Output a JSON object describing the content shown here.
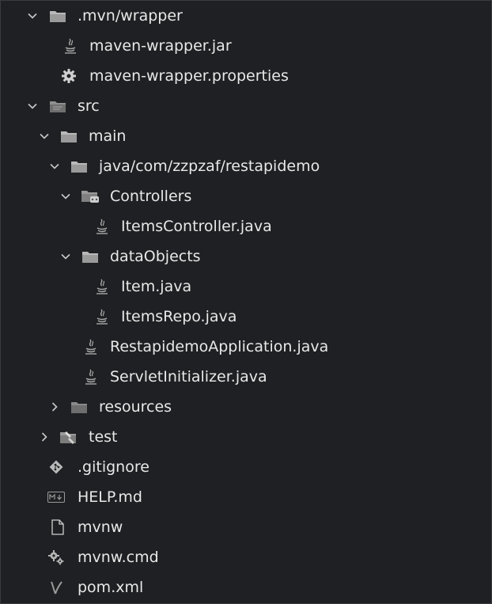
{
  "tree": {
    "items": [
      {
        "label": ".mvn/wrapper",
        "type": "folder",
        "state": "expanded",
        "icon": "folder-icon"
      },
      {
        "label": "maven-wrapper.jar",
        "type": "file",
        "icon": "java-file-icon"
      },
      {
        "label": "maven-wrapper.properties",
        "type": "file",
        "icon": "gear-icon"
      },
      {
        "label": "src",
        "type": "folder",
        "state": "expanded",
        "icon": "folder-icon"
      },
      {
        "label": "main",
        "type": "folder",
        "state": "expanded",
        "icon": "folder-icon"
      },
      {
        "label": "java/com/zzpzaf/restapidemo",
        "type": "folder",
        "state": "expanded",
        "icon": "folder-icon"
      },
      {
        "label": "Controllers",
        "type": "folder",
        "state": "expanded",
        "icon": "controllers-folder-icon"
      },
      {
        "label": "ItemsController.java",
        "type": "file",
        "icon": "java-file-icon"
      },
      {
        "label": "dataObjects",
        "type": "folder",
        "state": "expanded",
        "icon": "folder-icon"
      },
      {
        "label": "Item.java",
        "type": "file",
        "icon": "java-file-icon"
      },
      {
        "label": "ItemsRepo.java",
        "type": "file",
        "icon": "java-file-icon"
      },
      {
        "label": "RestapidemoApplication.java",
        "type": "file",
        "icon": "java-file-icon"
      },
      {
        "label": "ServletInitializer.java",
        "type": "file",
        "icon": "java-file-icon"
      },
      {
        "label": "resources",
        "type": "folder",
        "state": "collapsed",
        "icon": "folder-icon"
      },
      {
        "label": "test",
        "type": "folder",
        "state": "collapsed",
        "icon": "test-folder-icon"
      },
      {
        "label": ".gitignore",
        "type": "file",
        "icon": "git-icon"
      },
      {
        "label": "HELP.md",
        "type": "file",
        "icon": "markdown-icon"
      },
      {
        "label": "mvnw",
        "type": "file",
        "icon": "file-icon"
      },
      {
        "label": "mvnw.cmd",
        "type": "file",
        "icon": "gears-icon"
      },
      {
        "label": "pom.xml",
        "type": "file",
        "icon": "maven-icon"
      }
    ]
  },
  "colors": {
    "background": "#1f2023",
    "text": "#e8e8e8",
    "icon": "#bdbdbd",
    "git": "#b8b8b8"
  }
}
